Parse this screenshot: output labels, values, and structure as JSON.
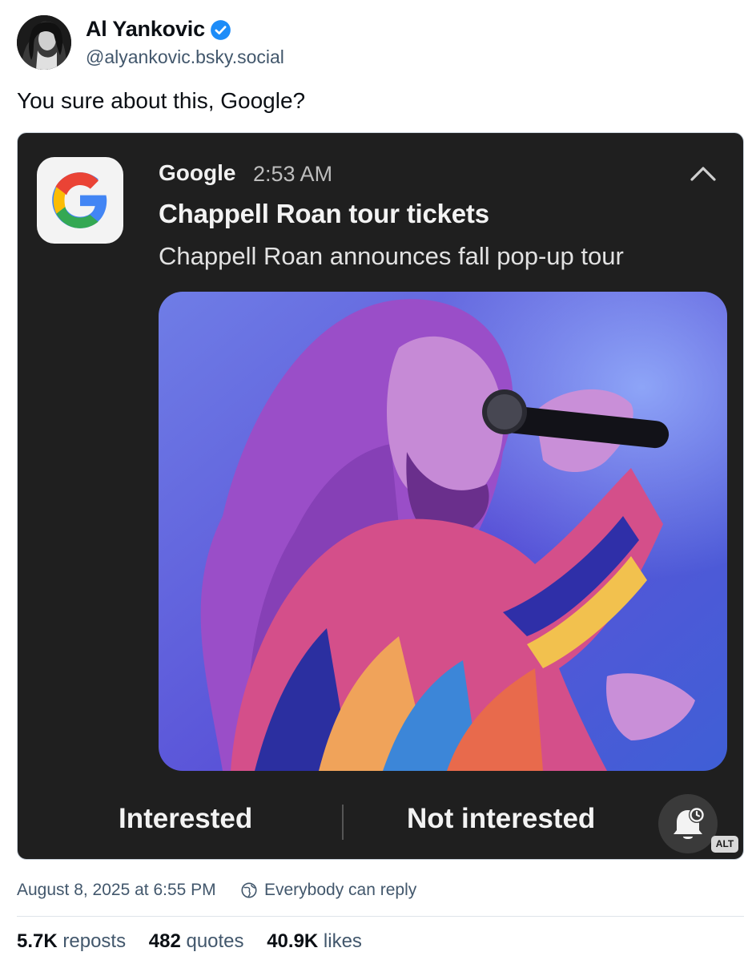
{
  "author": {
    "name": "Al Yankovic",
    "handle": "@alyankovic.bsky.social",
    "verified": true
  },
  "post": {
    "text": "You sure about this, Google?",
    "timestamp": "August 8, 2025 at 6:55 PM",
    "reply_setting": "Everybody can reply"
  },
  "notification": {
    "app": "Google",
    "time": "2:53 AM",
    "title": "Chappell Roan tour tickets",
    "body": "Chappell Roan announces fall pop-up tour",
    "actions": {
      "interested": "Interested",
      "not_interested": "Not interested"
    }
  },
  "image": {
    "alt_badge": "ALT"
  },
  "stats": {
    "reposts": {
      "count": "5.7K",
      "label": "reposts"
    },
    "quotes": {
      "count": "482",
      "label": "quotes"
    },
    "likes": {
      "count": "40.9K",
      "label": "likes"
    }
  },
  "colors": {
    "verified": "#1d8cf8",
    "muted_text": "#42576c",
    "embed_background": "#1f1f1f"
  },
  "icons": {
    "verified": "verified-check-icon",
    "collapse": "chevron-up-icon",
    "bell": "bell-snooze-icon",
    "reply": "globe-reply-icon"
  }
}
